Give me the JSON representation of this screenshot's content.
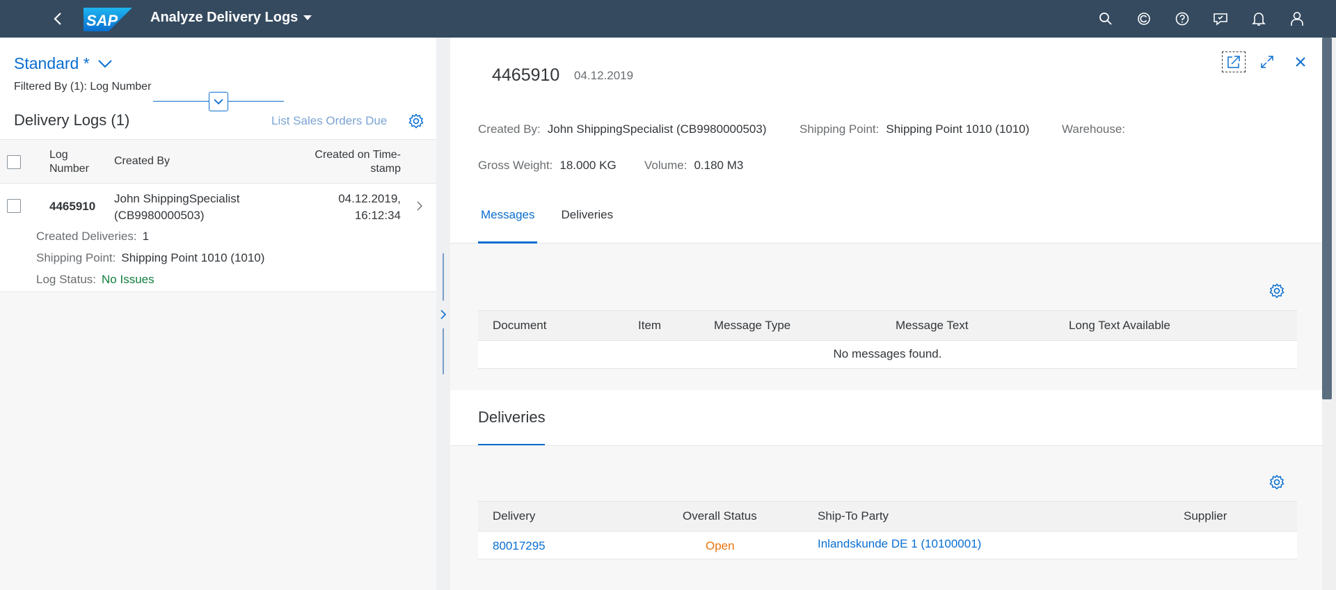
{
  "shell": {
    "title": "Analyze Delivery Logs",
    "logo_text": "SAP",
    "icons": [
      "search-icon",
      "copilot-icon",
      "help-icon",
      "feedback-icon",
      "notifications-icon",
      "user-icon"
    ]
  },
  "left": {
    "variant": "Standard *",
    "filtered_by": "Filtered By (1): Log Number",
    "list_title": "Delivery Logs (1)",
    "list_sales_orders": "List Sales Orders Due",
    "columns": {
      "log_number_1": "Log",
      "log_number_2": "Number",
      "created_by": "Created By",
      "ts_1": "Created on Time-",
      "ts_2": "stamp"
    },
    "rows": [
      {
        "log_number": "4465910",
        "created_by_1": "John ShippingSpecialist",
        "created_by_2": "(CB9980000503)",
        "ts_1": "04.12.2019,",
        "ts_2": "16:12:34",
        "created_deliveries_label": "Created Deliveries:",
        "created_deliveries_value": "1",
        "shipping_point_label": "Shipping Point:",
        "shipping_point_value": "Shipping Point 1010 (1010)",
        "log_status_label": "Log Status:",
        "log_status_value": "No Issues"
      }
    ]
  },
  "right": {
    "title": "4465910",
    "date": "04.12.2019",
    "created_by_label": "Created By:",
    "created_by_value": "John ShippingSpecialist (CB9980000503)",
    "shipping_point_label": "Shipping Point:",
    "shipping_point_value": "Shipping Point 1010 (1010)",
    "warehouse_label": "Warehouse:",
    "gross_weight_label": "Gross Weight:",
    "gross_weight_value": "18.000 KG",
    "volume_label": "Volume:",
    "volume_value": "0.180 M3",
    "tabs": [
      "Messages",
      "Deliveries"
    ],
    "messages": {
      "columns": [
        "Document",
        "Item",
        "Message Type",
        "Message Text",
        "Long Text Available"
      ],
      "empty_text": "No messages found."
    },
    "deliveries": {
      "title": "Deliveries",
      "columns": [
        "Delivery",
        "Overall Status",
        "Ship-To Party",
        "Supplier"
      ],
      "rows": [
        {
          "delivery": "80017295",
          "status": "Open",
          "ship_to": "Inlandskunde DE 1 (10100001)",
          "supplier": ""
        }
      ]
    }
  },
  "colors": {
    "shell_bg": "#354a5f",
    "accent": "#0a6ed1",
    "positive": "#107e3e",
    "critical": "#e9730c"
  }
}
